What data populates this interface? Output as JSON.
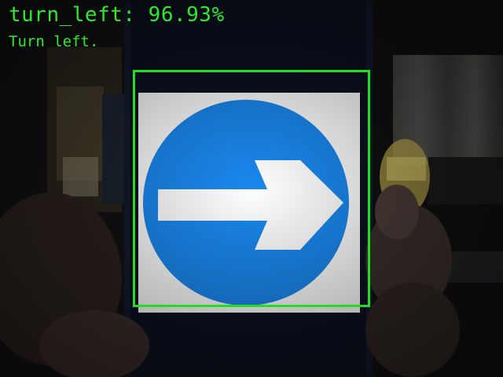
{
  "overlay": {
    "prediction_text": "turn_left: 96.93%",
    "description_text": "Turn left.",
    "text_color": "#2ee82e",
    "box_color": "#22dd22"
  },
  "sign": {
    "icon": "turn-right-arrow-icon",
    "circle_color": "#1a88ee",
    "arrow_color": "#ffffff",
    "panel_color": "#ffffff"
  }
}
